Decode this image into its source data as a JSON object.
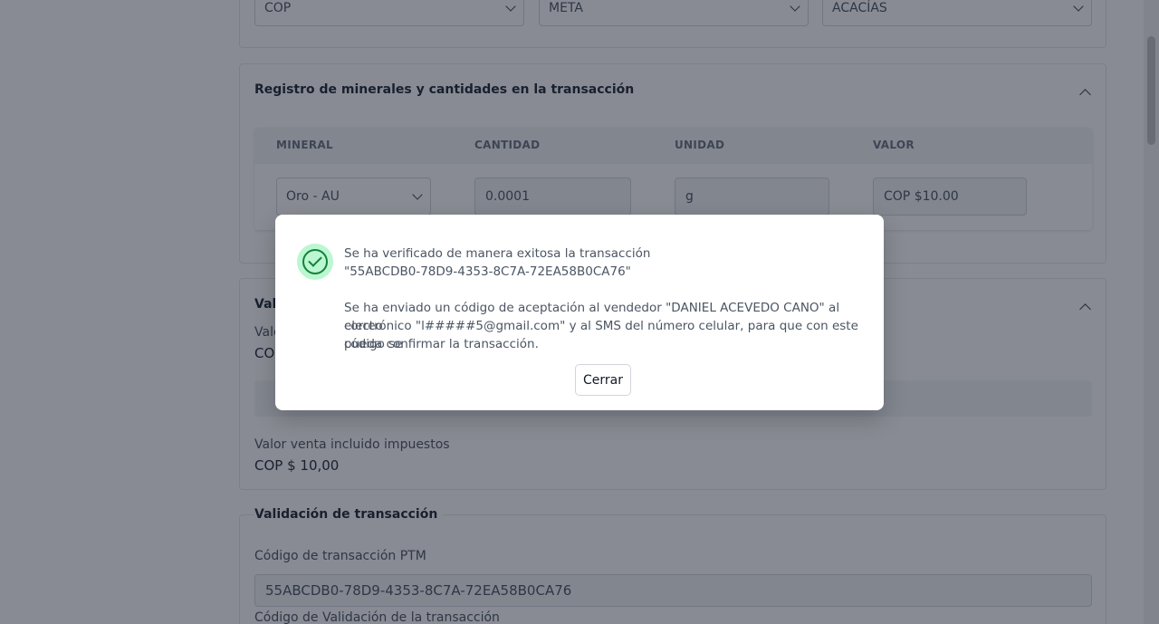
{
  "location": {
    "currency": "COP",
    "department": "META",
    "municipality": "ACACÍAS"
  },
  "minerals_section": {
    "title": "Registro de minerales y cantidades en la transacción",
    "columns": [
      "MINERAL",
      "CANTIDAD",
      "UNIDAD",
      "VALOR"
    ],
    "row": {
      "mineral": "Oro - AU",
      "quantity": "0.0001",
      "unit": "g",
      "value": "COP $10.00"
    }
  },
  "values_section": {
    "title_partial": "Val",
    "label_partial": "Valo",
    "value_partial": "CO",
    "sale_total_label": "Valor venta incluido impuestos",
    "sale_total_value": "COP $ 10,00"
  },
  "validation_section": {
    "title": "Validación de transacción",
    "ptm_code_label": "Código de transacción PTM",
    "ptm_code_value": "55ABCDB0-78D9-4353-8C7A-72EA58B0CA76",
    "validation_code_label": "Código de Validación de la transacción"
  },
  "modal": {
    "line1": "Se ha verificado de manera exitosa la transacción",
    "line2": "\"55ABCDB0-78D9-4353-8C7A-72EA58B0CA76\"",
    "line3": "Se ha enviado un código de aceptación al vendedor \"DANIEL ACEVEDO CANO\" al correo",
    "line4": "electrónico \"l#####5@gmail.com\" y al SMS del número celular, para que con este código se",
    "line5": "pueda confirmar la transacción.",
    "close_label": "Cerrar",
    "icon": "check-circle-icon",
    "accent_color": "#15803d"
  }
}
